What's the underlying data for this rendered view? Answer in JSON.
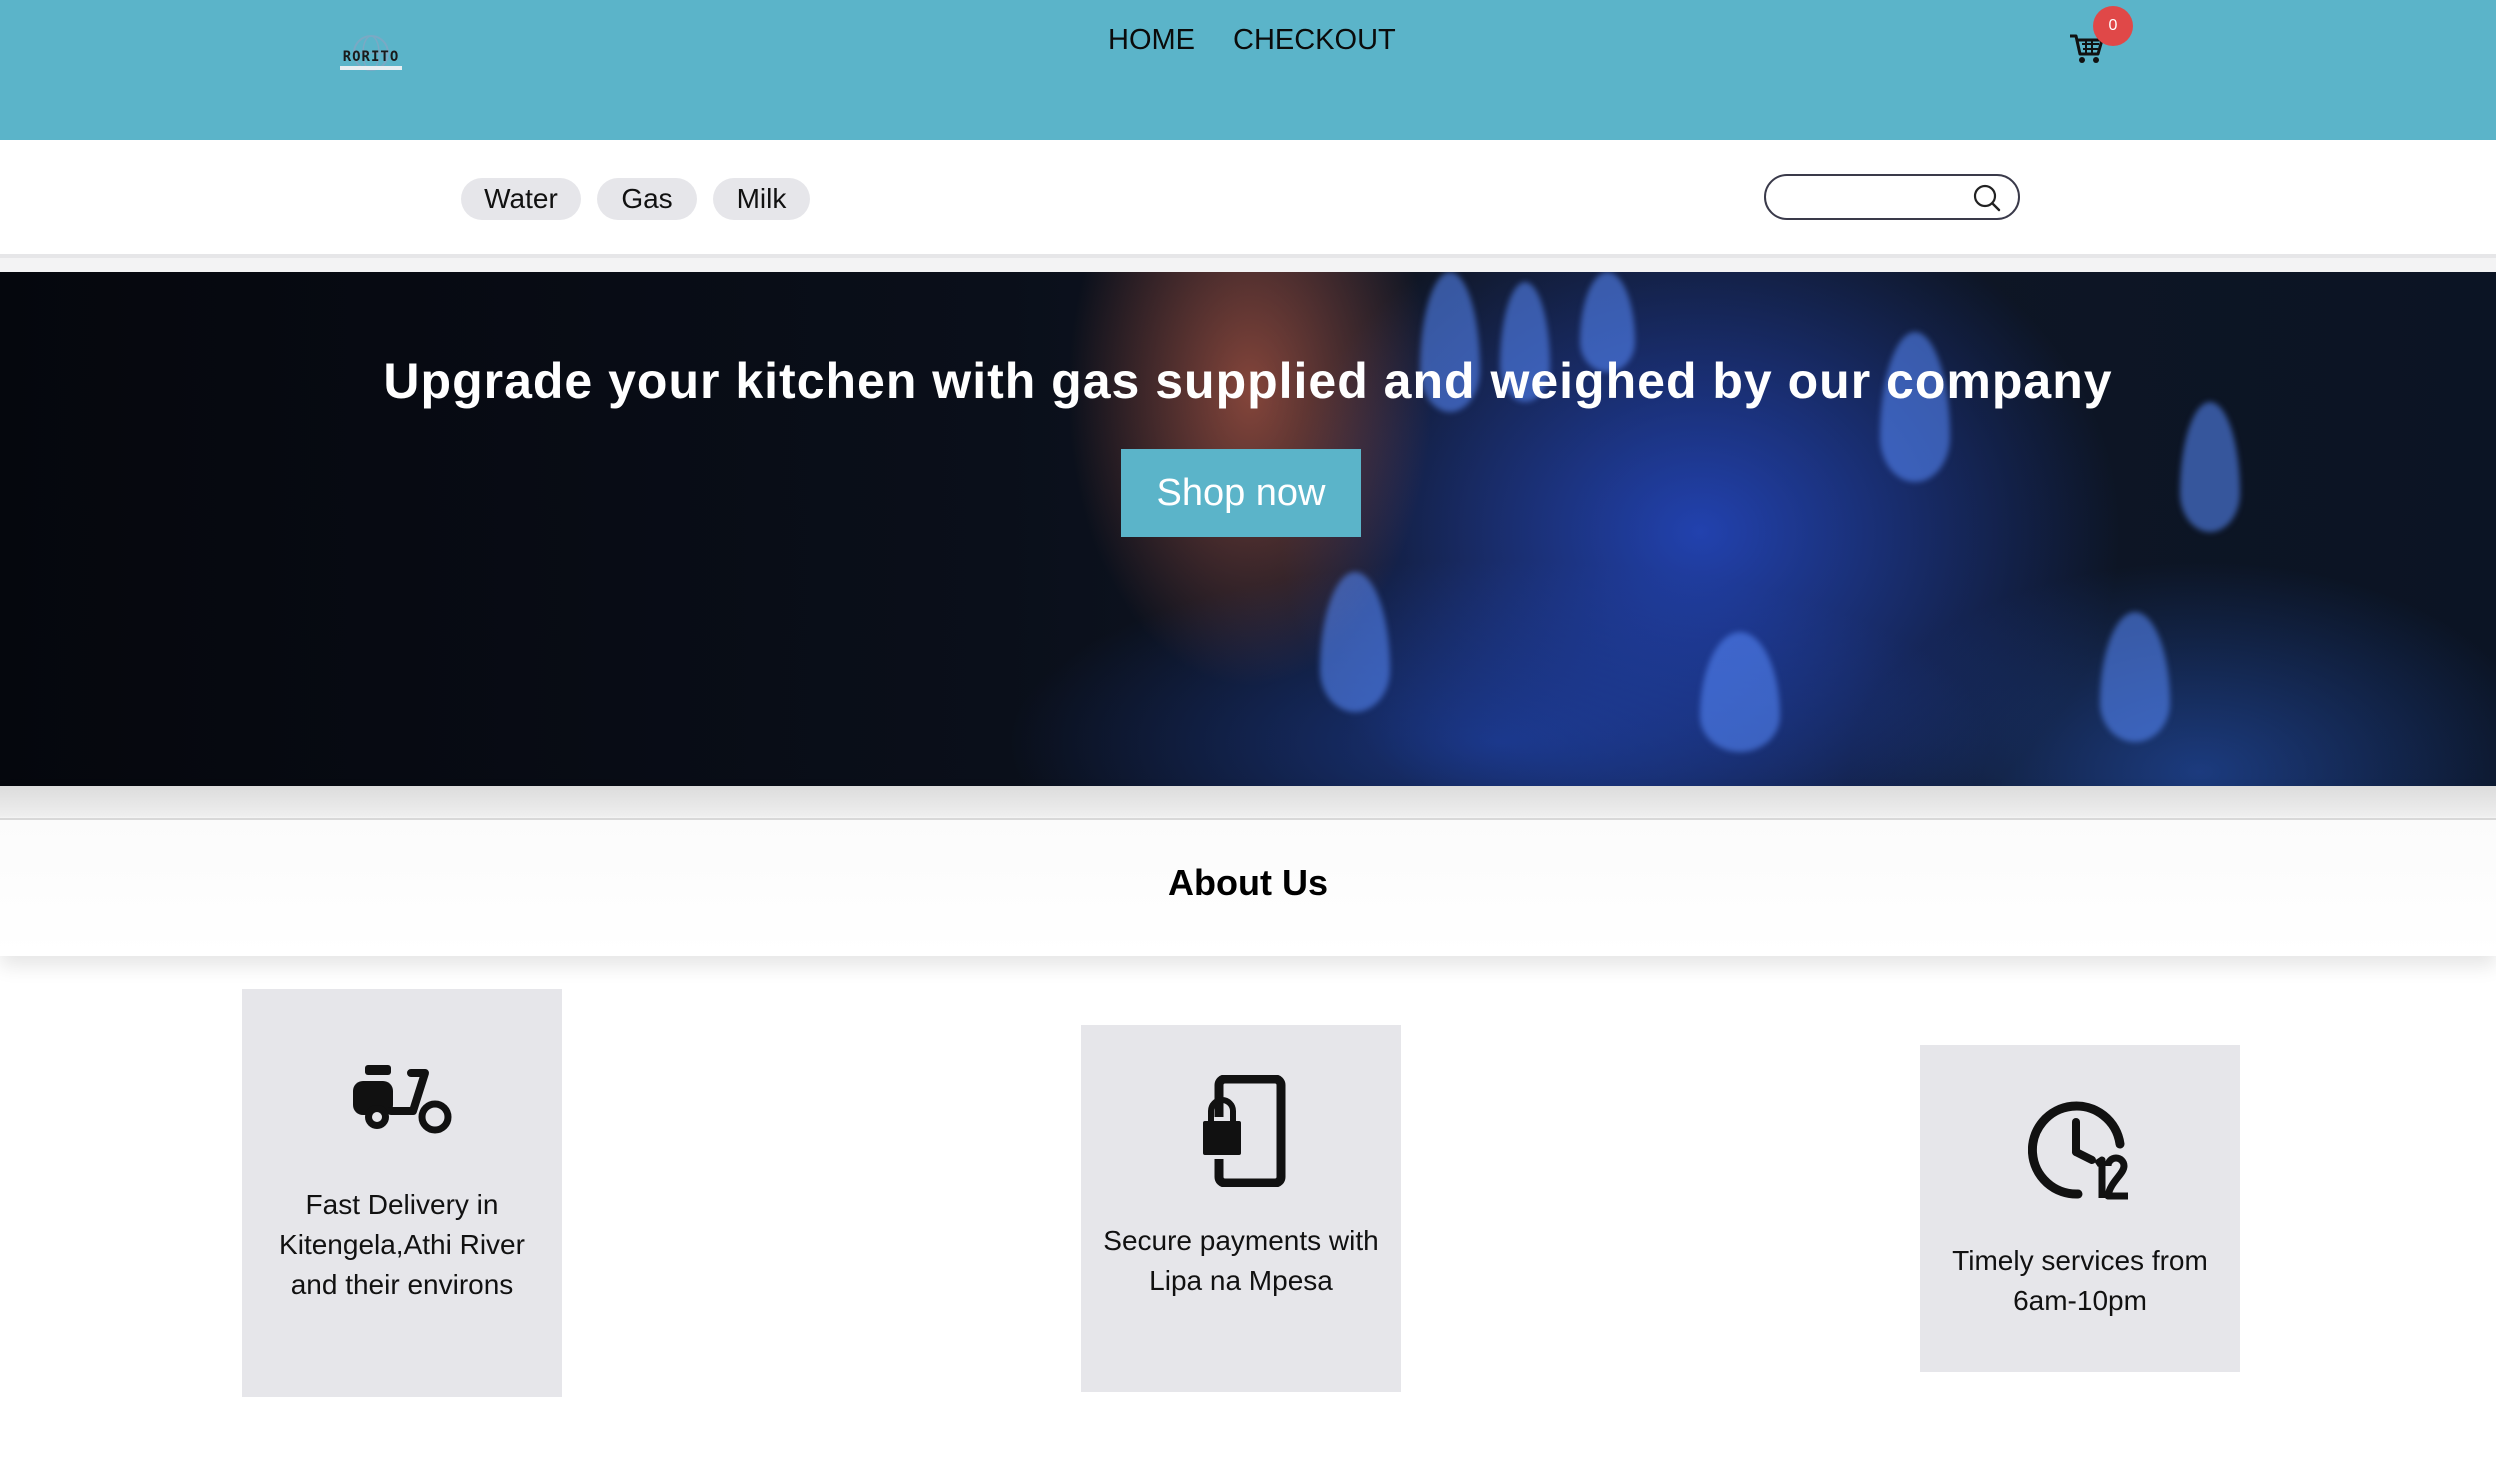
{
  "header": {
    "logo_text": "RORITO",
    "nav": [
      {
        "label": "HOME"
      },
      {
        "label": "CHECKOUT"
      }
    ],
    "cart_count": "0",
    "colors": {
      "brand": "#5bb4c9",
      "badge": "#e04848"
    }
  },
  "categories": [
    {
      "label": "Water"
    },
    {
      "label": "Gas"
    },
    {
      "label": "Milk"
    }
  ],
  "search": {
    "placeholder": "",
    "value": "",
    "icon": "search-icon"
  },
  "hero": {
    "title": "Upgrade your kitchen with gas supplied and weighed by our company",
    "button_label": "Shop now"
  },
  "about": {
    "title": "About Us",
    "features": [
      {
        "icon": "scooter-icon",
        "text": "Fast Delivery in Kitengela,Athi River and their environs"
      },
      {
        "icon": "phone-lock-icon",
        "text": "Secure payments with Lipa na Mpesa"
      },
      {
        "icon": "clock-12-icon",
        "text": "Timely services from 6am-10pm"
      }
    ]
  }
}
